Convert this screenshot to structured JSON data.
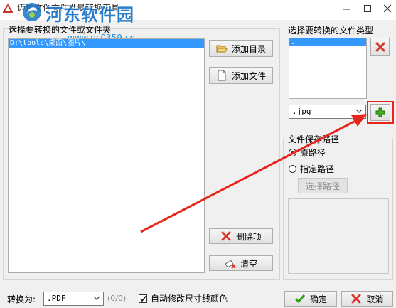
{
  "window": {
    "title": "迈迪文件文件批量转换工具"
  },
  "watermark": {
    "title": "河东软件园",
    "url": "www.pc0359.cn"
  },
  "left_panel": {
    "label": "选择要转换的文件或文件夹",
    "items": [
      "D:\\tools\\桌面\\图片\\"
    ],
    "add_dir_label": "添加目录",
    "add_file_label": "添加文件",
    "delete_label": "删除项",
    "clear_label": "清空"
  },
  "type_panel": {
    "label": "选择要转换的文件类型",
    "items": [
      "."
    ],
    "combo_value": ".jpg"
  },
  "save_panel": {
    "label": "文件保存路径",
    "option_original": "原路径",
    "option_custom": "指定路径",
    "selected": "原路径",
    "choose_path_label": "选择路径"
  },
  "bottom": {
    "convert_label": "转换为:",
    "convert_value": ".PDF",
    "count_text": "(0/0)",
    "auto_fix_label": "自动修改尺寸线颜色",
    "auto_fix_checked": true,
    "ok_label": "确定",
    "cancel_label": "取消"
  },
  "colors": {
    "selection": "#3399ff",
    "highlight_box": "#e8251b",
    "arrow": "#e8251b",
    "watermark_blue": "#1a73c7"
  }
}
